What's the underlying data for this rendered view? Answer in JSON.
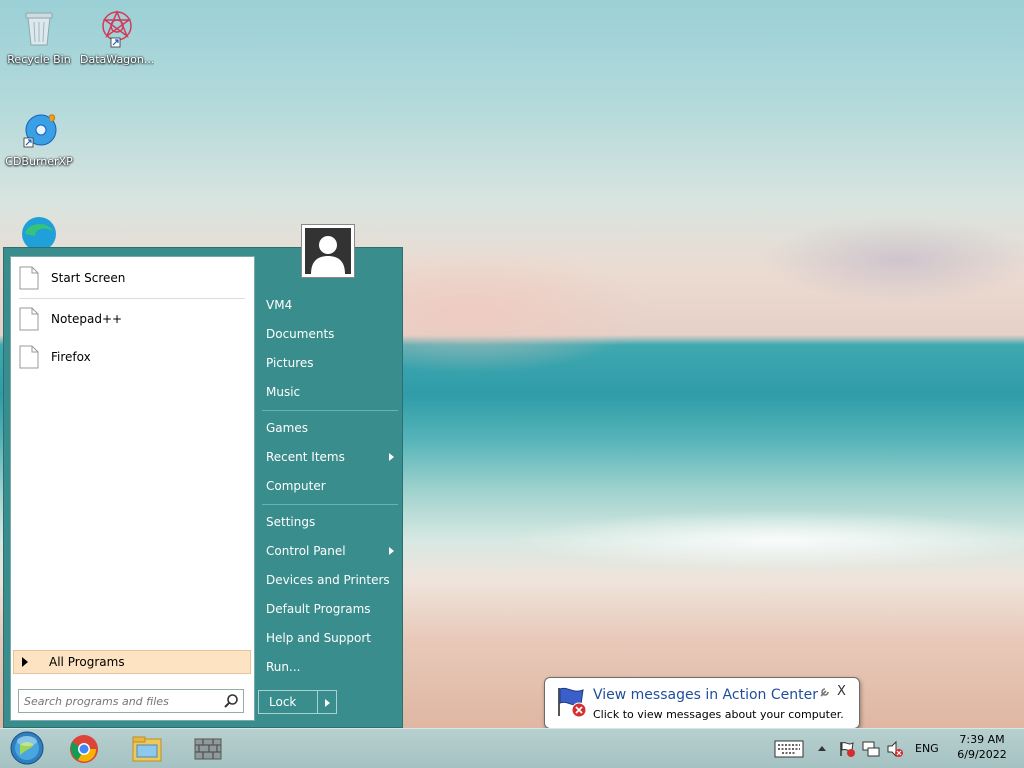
{
  "desktop": {
    "icons": [
      {
        "label": "Recycle Bin",
        "icon": "recycle-bin-icon"
      },
      {
        "label": "DataWagon...",
        "icon": "datawagon-icon"
      },
      {
        "label": "CDBurnerXP",
        "icon": "cdburnerxp-icon"
      },
      {
        "label": "",
        "icon": "edge-icon"
      }
    ]
  },
  "start_menu": {
    "left_pane": {
      "pinned": [
        {
          "label": "Start Screen"
        }
      ],
      "recent": [
        {
          "label": "Notepad++"
        },
        {
          "label": "Firefox"
        }
      ],
      "all_programs_label": "All Programs",
      "search": {
        "placeholder": "Search programs and files"
      }
    },
    "right_pane": {
      "group1": [
        {
          "label": "VM4"
        },
        {
          "label": "Documents"
        },
        {
          "label": "Pictures"
        },
        {
          "label": "Music"
        }
      ],
      "group2": [
        {
          "label": "Games"
        },
        {
          "label": "Recent Items",
          "submenu": true
        },
        {
          "label": "Computer"
        }
      ],
      "group3": [
        {
          "label": "Settings"
        },
        {
          "label": "Control Panel",
          "submenu": true
        },
        {
          "label": "Devices and Printers"
        },
        {
          "label": "Default Programs"
        },
        {
          "label": "Help and Support"
        },
        {
          "label": "Run..."
        }
      ]
    },
    "lock_label": "Lock"
  },
  "notification": {
    "title": "View messages in Action Center",
    "text": "Click to view messages about your computer.",
    "close": "X"
  },
  "taskbar": {
    "pinned": [
      "start-orb-icon",
      "chrome-icon",
      "file-explorer-icon",
      "firewall-icon"
    ],
    "tray": {
      "language": "ENG",
      "time": "7:39 AM",
      "date": "6/9/2022"
    }
  },
  "colors": {
    "start_menu_bg": "#3a8d8d",
    "all_programs_highlight": "#fde3c2",
    "balloon_title": "#1f4f9c"
  }
}
